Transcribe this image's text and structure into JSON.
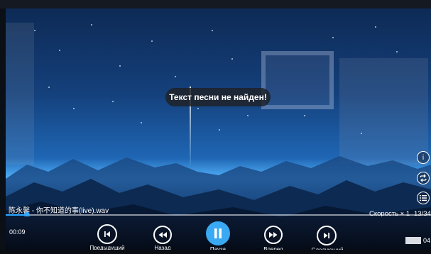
{
  "notification": {
    "text": "Текст песни не найден!"
  },
  "track": {
    "title": "陈永馨 - 你不知道的事(live).wav",
    "current_time": "00:09",
    "total_time_visible": "04",
    "progress": 0.05
  },
  "playback": {
    "speed_label": "Скорость × 1",
    "counter": "13/34"
  },
  "controls": {
    "previous_label": "Предыдущий",
    "rewind_label": "Назад",
    "pause_label": "Пауза",
    "forward_label": "Вперед",
    "next_label": "Следующий"
  },
  "side_buttons": {
    "info_icon": "info-icon",
    "repeat_icon": "repeat-icon",
    "playlist_icon": "playlist-icon"
  },
  "colors": {
    "accent": "#3aa9f3",
    "progress": "#2fa8ff",
    "toast_background": "#1e2228"
  }
}
